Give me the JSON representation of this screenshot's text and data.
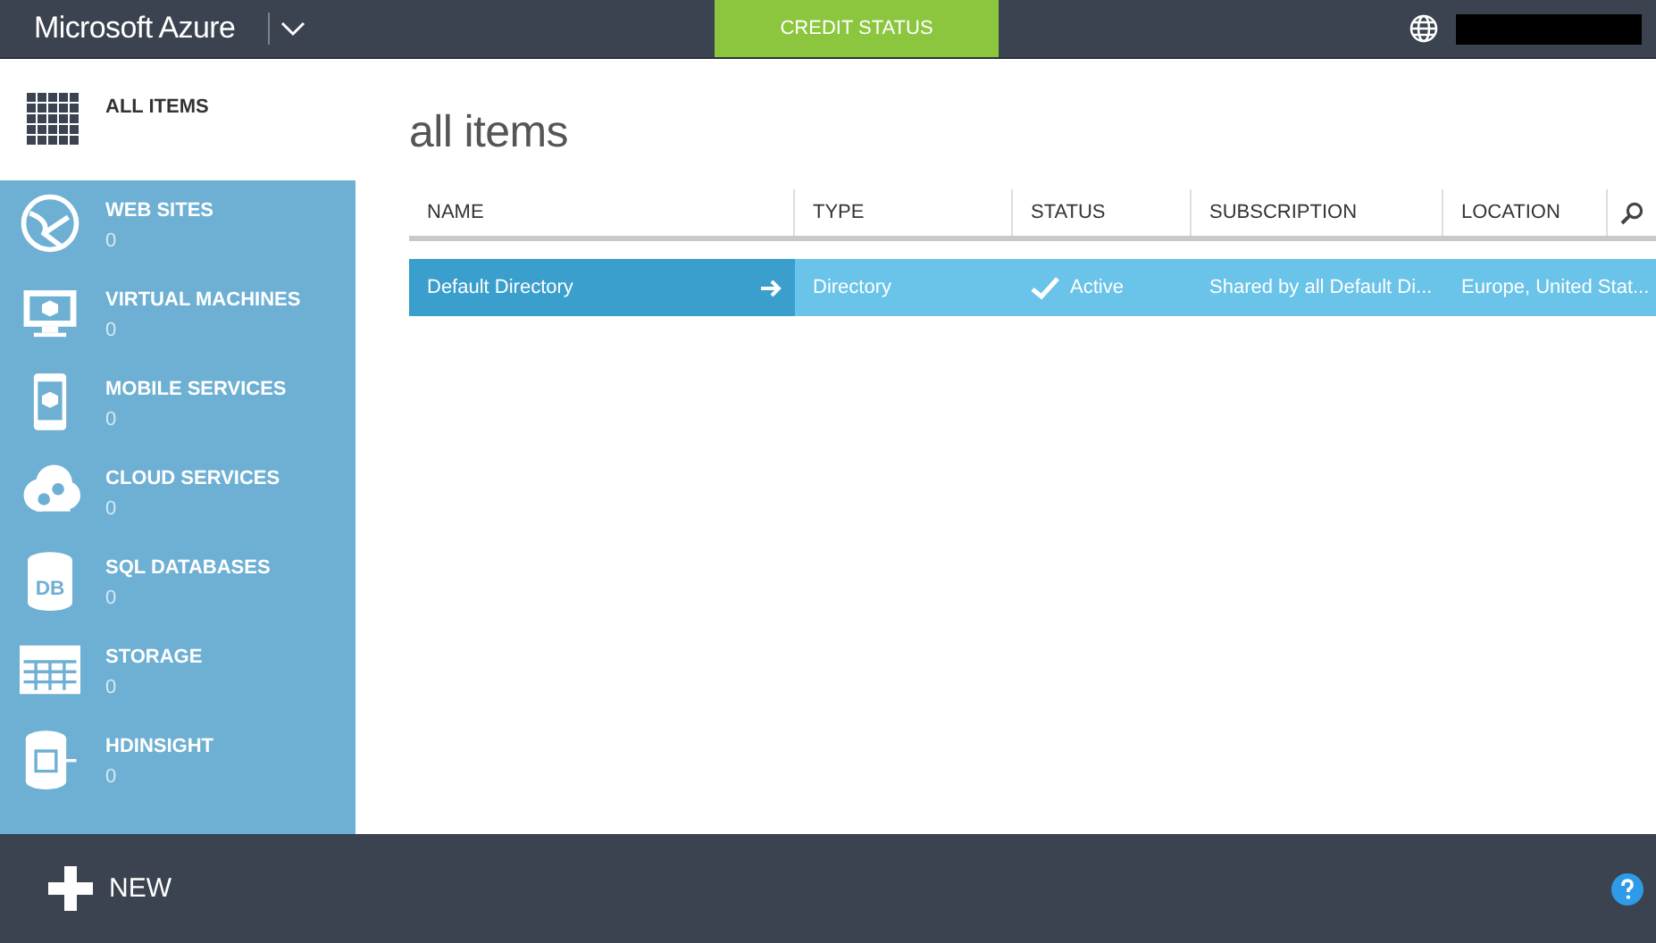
{
  "top_bar": {
    "brand": "Microsoft Azure",
    "credit_status": "CREDIT STATUS"
  },
  "sidebar": {
    "items": [
      {
        "label": "ALL ITEMS",
        "selected": true
      },
      {
        "label": "WEB SITES",
        "count": "0",
        "selected": false
      },
      {
        "label": "VIRTUAL MACHINES",
        "count": "0",
        "selected": false
      },
      {
        "label": "MOBILE SERVICES",
        "count": "0",
        "selected": false
      },
      {
        "label": "CLOUD SERVICES",
        "count": "0",
        "selected": false
      },
      {
        "label": "SQL DATABASES",
        "count": "0",
        "icon_text": "DB",
        "selected": false
      },
      {
        "label": "STORAGE",
        "count": "0",
        "selected": false
      },
      {
        "label": "HDINSIGHT",
        "count": "0",
        "selected": false
      }
    ]
  },
  "main": {
    "title": "all items",
    "table": {
      "columns": [
        "NAME",
        "TYPE",
        "STATUS",
        "SUBSCRIPTION",
        "LOCATION"
      ],
      "rows": [
        {
          "name": "Default Directory",
          "type": "Directory",
          "status": "Active",
          "subscription": "Shared by all Default Di...",
          "location": "Europe, United Stat...",
          "selected": true
        }
      ]
    }
  },
  "footer": {
    "new_button": "NEW"
  }
}
